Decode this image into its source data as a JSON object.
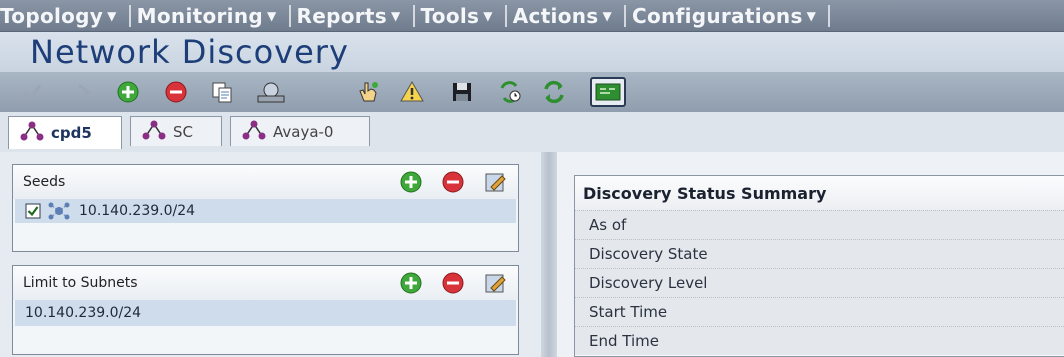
{
  "menu": [
    {
      "label": "Topology"
    },
    {
      "label": "Monitoring"
    },
    {
      "label": "Reports"
    },
    {
      "label": "Tools"
    },
    {
      "label": "Actions"
    },
    {
      "label": "Configurations"
    }
  ],
  "page": {
    "title": "Network Discovery"
  },
  "toolbar": {
    "icons": [
      "check-icon",
      "forward-icon",
      "add-icon",
      "remove-icon",
      "copy-icon",
      "scanner-icon",
      "hand-pointer-icon",
      "warning-icon",
      "save-icon",
      "refresh-clock-icon",
      "refresh-icon",
      "console-icon"
    ]
  },
  "tabs": [
    {
      "label": "cpd5",
      "active": true
    },
    {
      "label": "SC",
      "active": false
    },
    {
      "label": "Avaya-0",
      "active": false
    }
  ],
  "seeds": {
    "title": "Seeds",
    "items": [
      {
        "value": "10.140.239.0/24",
        "checked": true
      }
    ]
  },
  "subnets": {
    "title": "Limit to Subnets",
    "items": [
      {
        "value": "10.140.239.0/24"
      }
    ]
  },
  "summary": {
    "title": "Discovery Status Summary",
    "rows": [
      {
        "label": "As of"
      },
      {
        "label": "Discovery State"
      },
      {
        "label": "Discovery Level"
      },
      {
        "label": "Start Time"
      },
      {
        "label": "End Time"
      }
    ]
  },
  "colors": {
    "title": "#1d3e78",
    "accent_add": "#3ea83a",
    "accent_remove": "#d8323a",
    "selection": "#cfdceb"
  }
}
